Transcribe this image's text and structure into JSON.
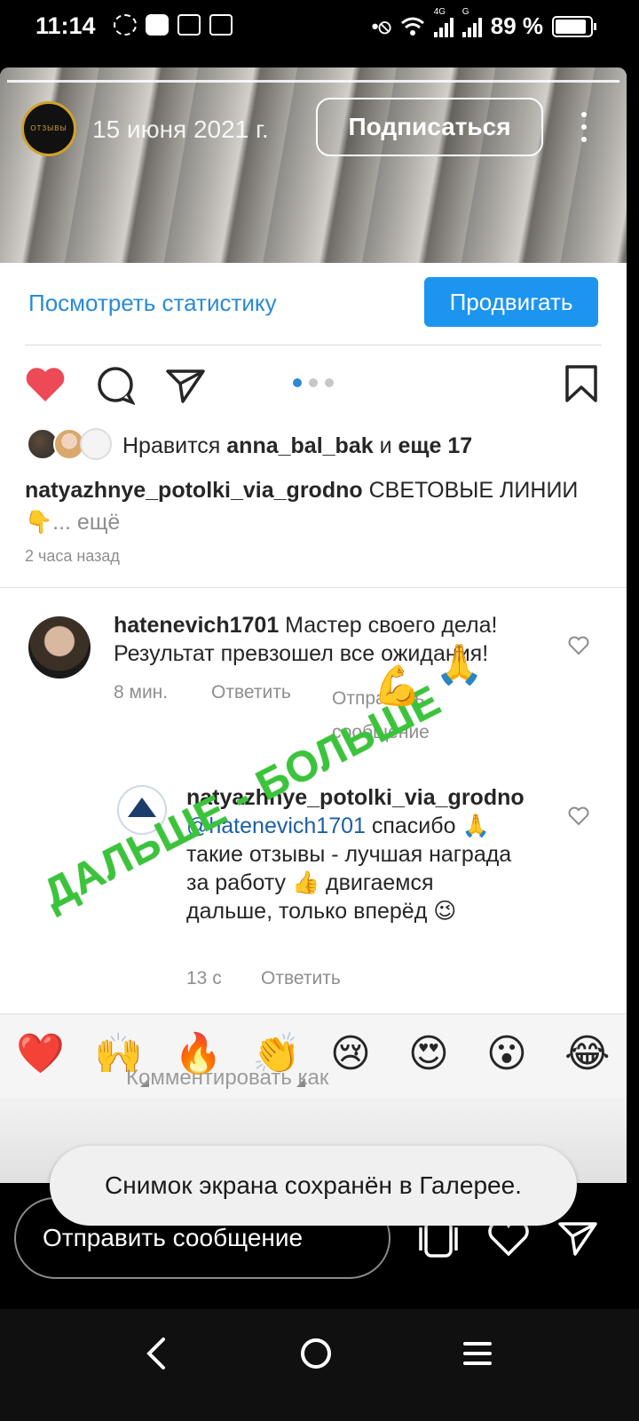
{
  "status_bar": {
    "time": "11:14",
    "battery": "89 %",
    "net_1": "4G",
    "net_2": "G",
    "icons": [
      "fan-icon",
      "youtube-icon",
      "calendar-icon",
      "calendar-icon",
      "nfc-icon",
      "wifi-icon",
      "signal-icon",
      "battery-icon"
    ]
  },
  "story": {
    "avatar_text": "ОТЗЫВЫ",
    "date": "15 июня 2021 г.",
    "follow_label": "Подписаться",
    "stats_link": "Посмотреть статистику",
    "promote_label": "Продвигать",
    "carousel_count": 3,
    "carousel_active": 0
  },
  "post": {
    "likes_prefix": "Нравится ",
    "likes_user": "anna_bal_bak",
    "likes_and": " и ",
    "likes_more": "еще 17",
    "caption_user": "natyazhnye_potolki_via_grodno",
    "caption_text": " СВЕТОВЫЕ ЛИНИИ",
    "caption_emoji": "👇",
    "caption_more": "... ещё",
    "time_ago": "2 часа назад"
  },
  "comments": [
    {
      "user": "hatenevich1701",
      "text": " Мастер своего дела! Результат превзошел все ожидания!",
      "time": "8 мин.",
      "reply": "Ответить",
      "send_message": "Отправить сообщение"
    },
    {
      "user": "natyazhnye_potolki_via_grodno",
      "mention": "@hatenevich1701",
      "text": " спасибо 🙏 такие отзывы - лучшая награда за работу 👍 двигаемся дальше, только вперёд 😉",
      "time": "13 с",
      "reply": "Ответить"
    }
  ],
  "watermark": {
    "text": "ДАЛЬШЕ - БОЛЬШЕ",
    "emoji_1": "💪",
    "emoji_2": "🙏"
  },
  "reactions": [
    "❤️",
    "🙌",
    "🔥",
    "👏",
    "😢",
    "😍",
    "😮",
    "😂"
  ],
  "comment_input": {
    "placeholder": "Комментировать как"
  },
  "bottom": {
    "send_message": "Отправить сообщение"
  },
  "toast": {
    "text": "Снимок экрана сохранён в Галерее."
  },
  "colors": {
    "link_blue": "#2a8ad6",
    "promote_blue": "#1c95f0",
    "like_red": "#ed4956",
    "watermark_green": "#3bc43b"
  }
}
